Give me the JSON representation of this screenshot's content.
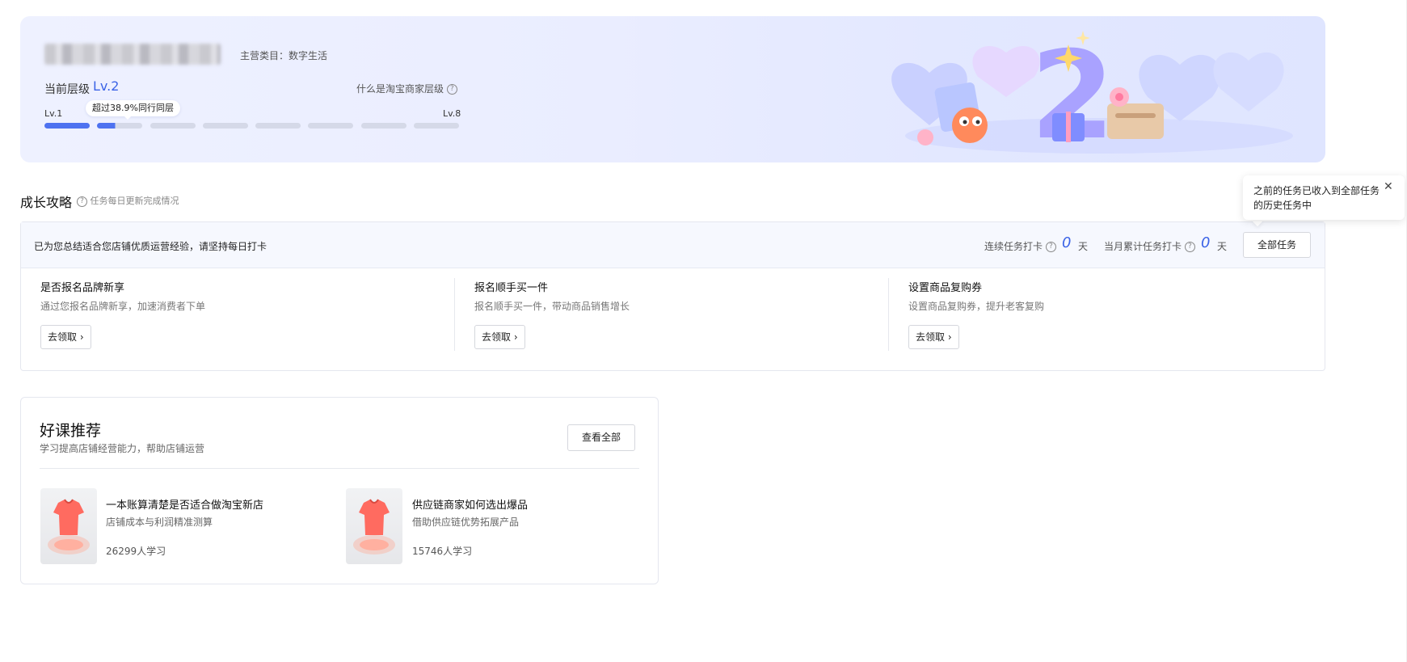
{
  "level_banner": {
    "category_text": "主营类目：数字生活",
    "current_level_label": "当前层级",
    "current_level_value": "Lv.2",
    "what_is_level_link": "什么是淘宝商家层级",
    "level_min": "Lv.1",
    "level_max": "Lv.8",
    "peer_tip": "超过38.9%同行同层",
    "progress": {
      "completed_segments": 1,
      "current_segment_fill": 0.4,
      "total_segments": 8
    }
  },
  "growth": {
    "title": "成长攻略",
    "note": "任务每日更新完成情况"
  },
  "tasks": {
    "header_text": "已为您总结适合您店铺优质运营经验，请坚持每日打卡",
    "streak_label": "连续任务打卡",
    "streak_value": "0",
    "month_label": "当月累计任务打卡",
    "month_value": "0",
    "day_unit": "天",
    "all_tasks_label": "全部任务",
    "items": [
      {
        "title": "是否报名品牌新享",
        "desc": "通过您报名品牌新享，加速消费者下单",
        "button": "去领取"
      },
      {
        "title": "报名顺手买一件",
        "desc": "报名顺手买一件，带动商品销售增长",
        "button": "去领取"
      },
      {
        "title": "设置商品复购券",
        "desc": "设置商品复购券，提升老客复购",
        "button": "去领取"
      }
    ]
  },
  "popover": {
    "text": "之前的任务已收入到全部任务的历史任务中",
    "close_icon": "close-icon"
  },
  "courses": {
    "title": "好课推荐",
    "subtitle": "学习提高店铺经营能力，帮助店铺运营",
    "view_all_label": "查看全部",
    "items": [
      {
        "name": "一本账算清楚是否适合做淘宝新店",
        "desc": "店铺成本与利润精准测算",
        "count": "26299人学习"
      },
      {
        "name": "供应链商家如何选出爆品",
        "desc": "借助供应链优势拓展产品",
        "count": "15746人学习"
      }
    ]
  },
  "colors": {
    "accent": "#3b63e6",
    "banner_bg": "#eaedff"
  }
}
